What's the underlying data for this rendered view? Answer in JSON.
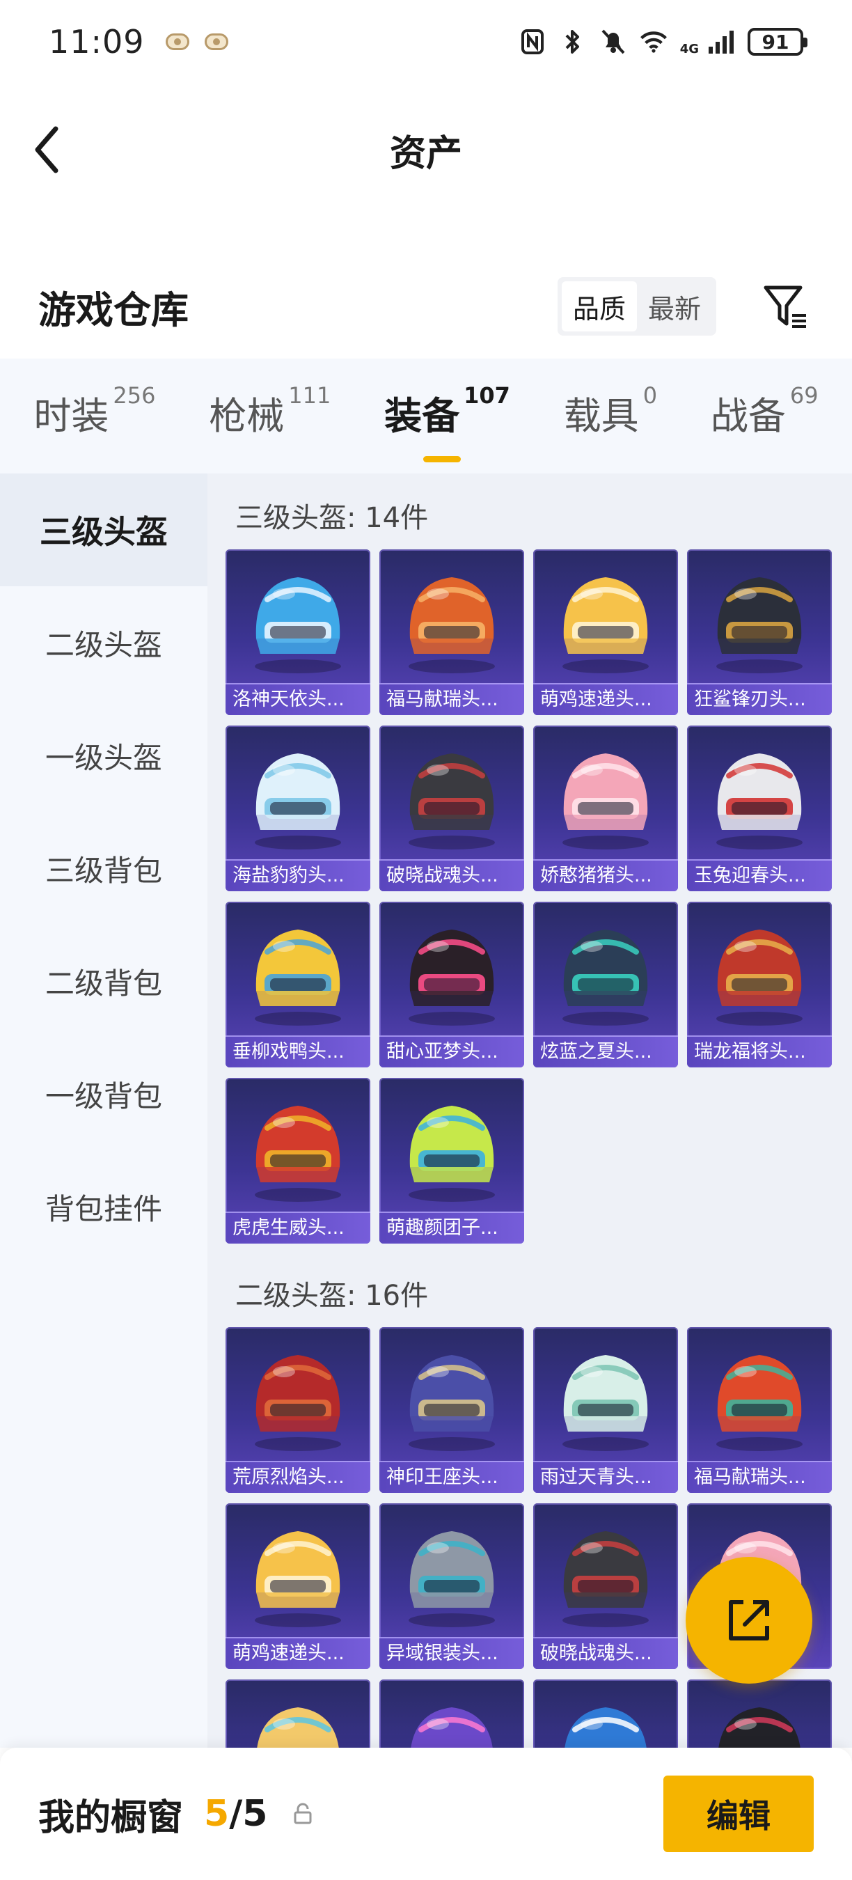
{
  "status": {
    "time": "11:09",
    "network": "4G",
    "battery": "91"
  },
  "header": {
    "title": "资产"
  },
  "section": {
    "title": "游戏仓库",
    "sort_options": [
      "品质",
      "最新"
    ],
    "active_sort": "品质"
  },
  "category_tabs": [
    {
      "label": "时装",
      "count": "256"
    },
    {
      "label": "枪械",
      "count": "111"
    },
    {
      "label": "装备",
      "count": "107"
    },
    {
      "label": "载具",
      "count": "0"
    },
    {
      "label": "战备",
      "count": "69"
    }
  ],
  "active_tab": "装备",
  "sidebar": {
    "items": [
      "三级头盔",
      "二级头盔",
      "一级头盔",
      "三级背包",
      "二级背包",
      "一级背包",
      "背包挂件"
    ],
    "active": "三级头盔"
  },
  "groups": [
    {
      "title": "三级头盔: 14件",
      "items": [
        {
          "name": "洛神天依头...",
          "icon": "helmet-icon",
          "color": "#3fa9e8",
          "accent": "#e8f4ff"
        },
        {
          "name": "福马献瑞头...",
          "icon": "helmet-icon",
          "color": "#e0632a",
          "accent": "#f7b267"
        },
        {
          "name": "萌鸡速递头...",
          "icon": "helmet-icon",
          "color": "#f6c24a",
          "accent": "#fff3d1"
        },
        {
          "name": "狂鲨锋刃头...",
          "icon": "helmet-icon",
          "color": "#2b2f3a",
          "accent": "#d9a441"
        },
        {
          "name": "海盐豹豹头...",
          "icon": "helmet-icon",
          "color": "#dff1fb",
          "accent": "#7ec8e8"
        },
        {
          "name": "破晓战魂头...",
          "icon": "helmet-icon",
          "color": "#3a3a40",
          "accent": "#c94040"
        },
        {
          "name": "娇憨猪猪头...",
          "icon": "helmet-icon",
          "color": "#f4a6b8",
          "accent": "#ffe3ea"
        },
        {
          "name": "玉兔迎春头...",
          "icon": "helmet-icon",
          "color": "#e8e8ec",
          "accent": "#d23232"
        },
        {
          "name": "垂柳戏鸭头...",
          "icon": "helmet-icon",
          "color": "#f3c73a",
          "accent": "#4aa3d8"
        },
        {
          "name": "甜心亚梦头...",
          "icon": "helmet-icon",
          "color": "#2a2028",
          "accent": "#ff4f8b"
        },
        {
          "name": "炫蓝之夏头...",
          "icon": "helmet-icon",
          "color": "#2b3e57",
          "accent": "#39d0c0"
        },
        {
          "name": "瑞龙福将头...",
          "icon": "helmet-icon",
          "color": "#c0392b",
          "accent": "#e7b04a"
        },
        {
          "name": "虎虎生威头...",
          "icon": "helmet-icon",
          "color": "#d33b2c",
          "accent": "#f0b429"
        },
        {
          "name": "萌趣颜团子...",
          "icon": "helmet-icon",
          "color": "#c6e84a",
          "accent": "#3ab0e0"
        }
      ]
    },
    {
      "title": "二级头盔: 16件",
      "items": [
        {
          "name": "荒原烈焰头...",
          "icon": "helmet-icon",
          "color": "#b52a2a",
          "accent": "#e06a3a"
        },
        {
          "name": "神印王座头...",
          "icon": "helmet-icon",
          "color": "#4b4fa8",
          "accent": "#d9c48a"
        },
        {
          "name": "雨过天青头...",
          "icon": "helmet-icon",
          "color": "#d8efe8",
          "accent": "#7cc4b3"
        },
        {
          "name": "福马献瑞头...",
          "icon": "helmet-icon",
          "color": "#e04a2a",
          "accent": "#3fb39a"
        },
        {
          "name": "萌鸡速递头...",
          "icon": "helmet-icon",
          "color": "#f6c24a",
          "accent": "#fff3d1"
        },
        {
          "name": "异域银装头...",
          "icon": "helmet-icon",
          "color": "#8e98a6",
          "accent": "#3bb3c9"
        },
        {
          "name": "破晓战魂头...",
          "icon": "helmet-icon",
          "color": "#3a3a40",
          "accent": "#c94040"
        },
        {
          "name": "",
          "icon": "helmet-icon",
          "color": "#f4a6b8",
          "accent": "#ffe3ea"
        },
        {
          "name": "",
          "icon": "helmet-icon",
          "color": "#f3c96a",
          "accent": "#59c6e3"
        },
        {
          "name": "",
          "icon": "helmet-icon",
          "color": "#6b49c9",
          "accent": "#ff7ad1"
        },
        {
          "name": "",
          "icon": "helmet-icon",
          "color": "#2f7ad6",
          "accent": "#ffffff"
        },
        {
          "name": "",
          "icon": "helmet-icon",
          "color": "#222228",
          "accent": "#d43a5a"
        }
      ]
    }
  ],
  "bottom": {
    "label": "我的橱窗",
    "used": "5",
    "separator": "/",
    "total": "5",
    "edit_label": "编辑"
  },
  "colors": {
    "accent": "#f5b400",
    "card_bg": "#3c3493"
  }
}
